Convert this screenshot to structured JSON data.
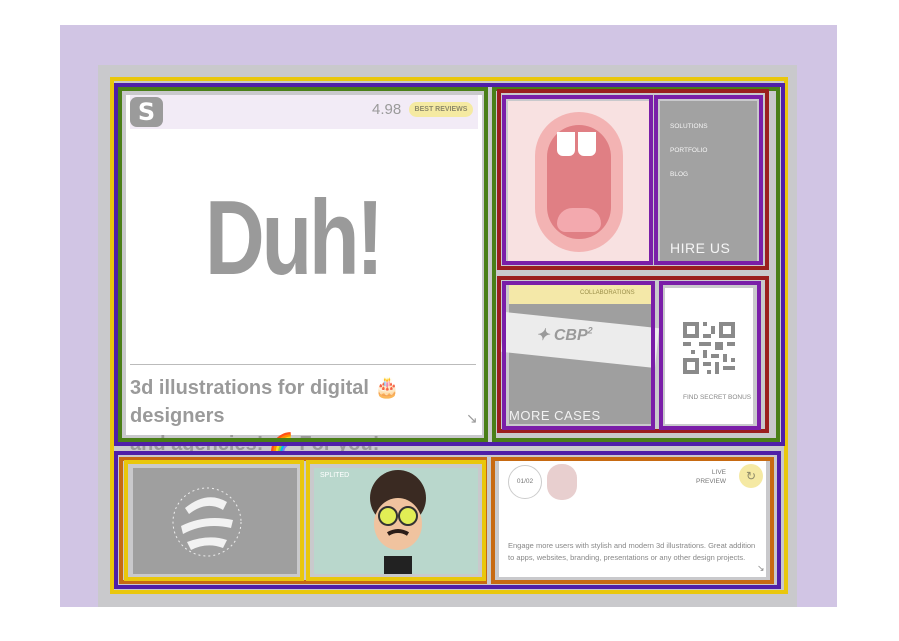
{
  "hero": {
    "logo": "S",
    "rating": "4.98",
    "badge": "BEST REVIEWS",
    "headline": "Duh!",
    "tagline_line1": "3d illustrations for digital 🎂 designers",
    "tagline_line2": "and agencies! 🌈 For you!",
    "arrow": "↘"
  },
  "menu": {
    "items": [
      "SOLUTIONS",
      "PORTFOLIO",
      "BLOG"
    ],
    "cta": "HIRE US"
  },
  "cases": {
    "collab": "COLLABORATIONS",
    "brand": "CBP",
    "brand_sup": "2",
    "label": "MORE CASES"
  },
  "qr": {
    "label": "FIND SECRET BONUS"
  },
  "bottom": {
    "splited": "SPLITED",
    "counter": "01/02",
    "live": "LIVE",
    "preview": "PREVIEW",
    "description": "Engage more users with stylish and modern 3d illustrations. Great addition to apps, websites, branding, presentations or any other design projects.",
    "arrow": "↘"
  },
  "colors": {
    "lavender": "#d1c5e4",
    "accent_yellow": "#f5eaa2",
    "outline_yellow": "#e9c70c",
    "outline_blue": "#4f1fa8",
    "outline_green": "#4a7f18",
    "outline_red": "#9b1e1e",
    "outline_purple": "#7a1ea8",
    "outline_orange": "#c76a12"
  }
}
